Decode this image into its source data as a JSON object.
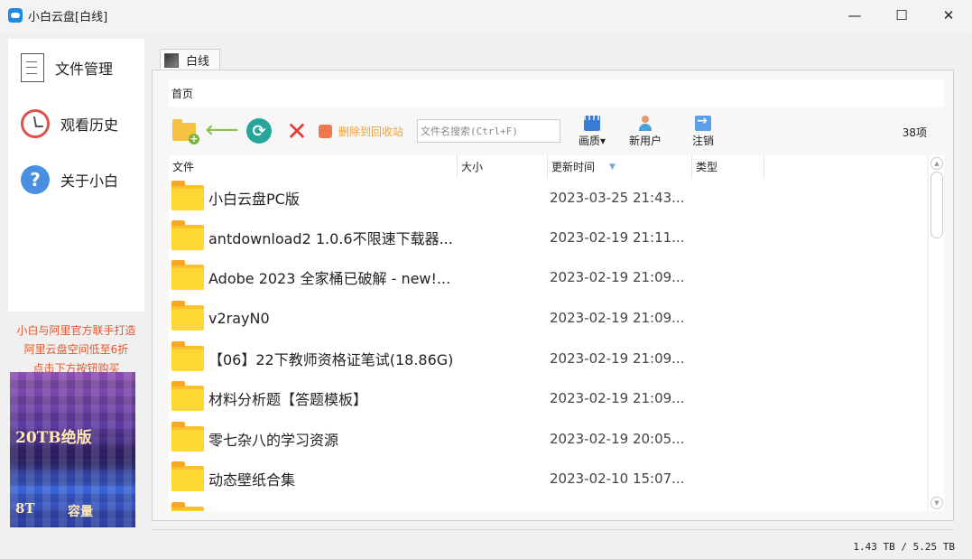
{
  "window": {
    "title": "小白云盘[白线]",
    "minimize_glyph": "—",
    "maximize_glyph": "☐",
    "close_glyph": "✕"
  },
  "sidebar": {
    "items": [
      {
        "label": "文件管理",
        "icon": "document-icon"
      },
      {
        "label": "观看历史",
        "icon": "history-icon"
      },
      {
        "label": "关于小白",
        "icon": "help-icon"
      }
    ],
    "help_glyph": "?"
  },
  "promo": {
    "line1": "小白与阿里官方联手打造",
    "line2": "阿里云盘空间低至6折",
    "line3": "点击下方按钮购买",
    "banner_text1": "20TB绝版",
    "banner_text2": "8T",
    "banner_text3": "容量"
  },
  "tab": {
    "label": "白线"
  },
  "breadcrumb": {
    "label": "首页"
  },
  "toolbar": {
    "back_glyph": "⟵",
    "refresh_glyph": "⟳",
    "delete_glyph": "✕",
    "recycle_label": "删除到回收站",
    "search_placeholder": "文件名搜索(Ctrl+F)",
    "quality_label": "画质",
    "quality_caret": "▾",
    "new_user_label": "新用户",
    "logout_label": "注销",
    "count": "38项"
  },
  "table": {
    "columns": [
      "文件",
      "大小",
      "更新时间",
      "类型"
    ],
    "sort_glyph": "▼",
    "rows": [
      {
        "name": "小白云盘PC版",
        "date": "2023-03-25 21:43..."
      },
      {
        "name": "antdownload2 1.0.6不限速下载器...",
        "date": "2023-02-19 21:11..."
      },
      {
        "name": "Adobe 2023 全家桶已破解 - new!...",
        "date": "2023-02-19 21:09..."
      },
      {
        "name": "v2rayN0",
        "date": "2023-02-19 21:09..."
      },
      {
        "name": "【06】22下教师资格证笔试(18.86G)",
        "date": "2023-02-19 21:09..."
      },
      {
        "name": "材料分析题【答题模板】",
        "date": "2023-02-19 21:09..."
      },
      {
        "name": "零七杂八的学习资源",
        "date": "2023-02-19 20:05..."
      },
      {
        "name": "动态壁纸合集",
        "date": "2023-02-10 15:07..."
      },
      {
        "name": "",
        "date": ""
      }
    ]
  },
  "scrollbar": {
    "up_glyph": "▲",
    "down_glyph": "▼"
  },
  "status": {
    "storage": "1.43 TB / 5.25 TB"
  }
}
